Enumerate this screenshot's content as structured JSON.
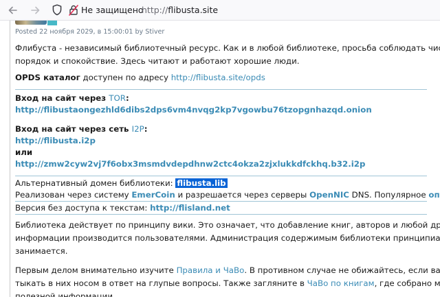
{
  "browser": {
    "insecure_label": "Не защищено",
    "url_protocol": "http://",
    "url_host": "flibusta.site"
  },
  "post": {
    "meta_prefix": "Posted 22 ноября 2029, в 15:00:01 by ",
    "author": "Stiver"
  },
  "intro": {
    "line1": "Флибуста - независимый библиотечный ресурс. Как и в любой библиотеке, просьба соблюдать чистоту,",
    "line2": "порядок и спокойствие. Здесь читают и работают хорошие люди."
  },
  "opds": {
    "label": "OPDS каталог",
    "text": " доступен по адресу ",
    "link": "http://flibusta.site/opds"
  },
  "tor": {
    "prefix": "Вход на сайт через ",
    "link": "TOR",
    "suffix": ":",
    "address": "http://flibustaongezhld6dibs2dps6vm4nvqg2kp7vgowbu76tzopgnhazqd.onion"
  },
  "i2p": {
    "prefix": "Вход на сайт через сеть ",
    "link": "I2P",
    "suffix": ":",
    "address1": "http://flibusta.i2p",
    "or": "или",
    "address2": "http://zmw2cyw2vj7f6obx3msmdvdepdhnw2ctc4okza2zjxlukkdfckhq.b32.i2p"
  },
  "alt": {
    "prefix": "Альтернативный домен библиотеки: ",
    "domain": "flibusta.lib",
    "t1": "Реализован через систему ",
    "emercoin": "EmerCoin",
    "t2": " и разрешается через серверы ",
    "opennic": "OpenNIC",
    "t3": " DNS. Популярное ",
    "desc": "описание",
    "t4": "."
  },
  "notext": {
    "prefix": "Версия без доступа к текстам: ",
    "link": "http://flisland.net"
  },
  "wiki": {
    "line1": "Библиотека действует по принципу вики. Это означает, что добавление книг, авторов и любой другой",
    "line2": "информации производится пользователями. Администрация содержимым библиотеки принципиально не",
    "line3": "занимается."
  },
  "rules": {
    "t1": "Первым делом внимательно изучите ",
    "link1": "Правила и ЧаВо",
    "t2": ". В противном случае не обижайтесь, если вас потом будут",
    "t3": "тыкать в них носом в ответ на глупые вопросы. Также загляните в ",
    "link2": "ЧаВо по книгам",
    "t4": ", где собрано много",
    "t5": "полезной информации."
  }
}
